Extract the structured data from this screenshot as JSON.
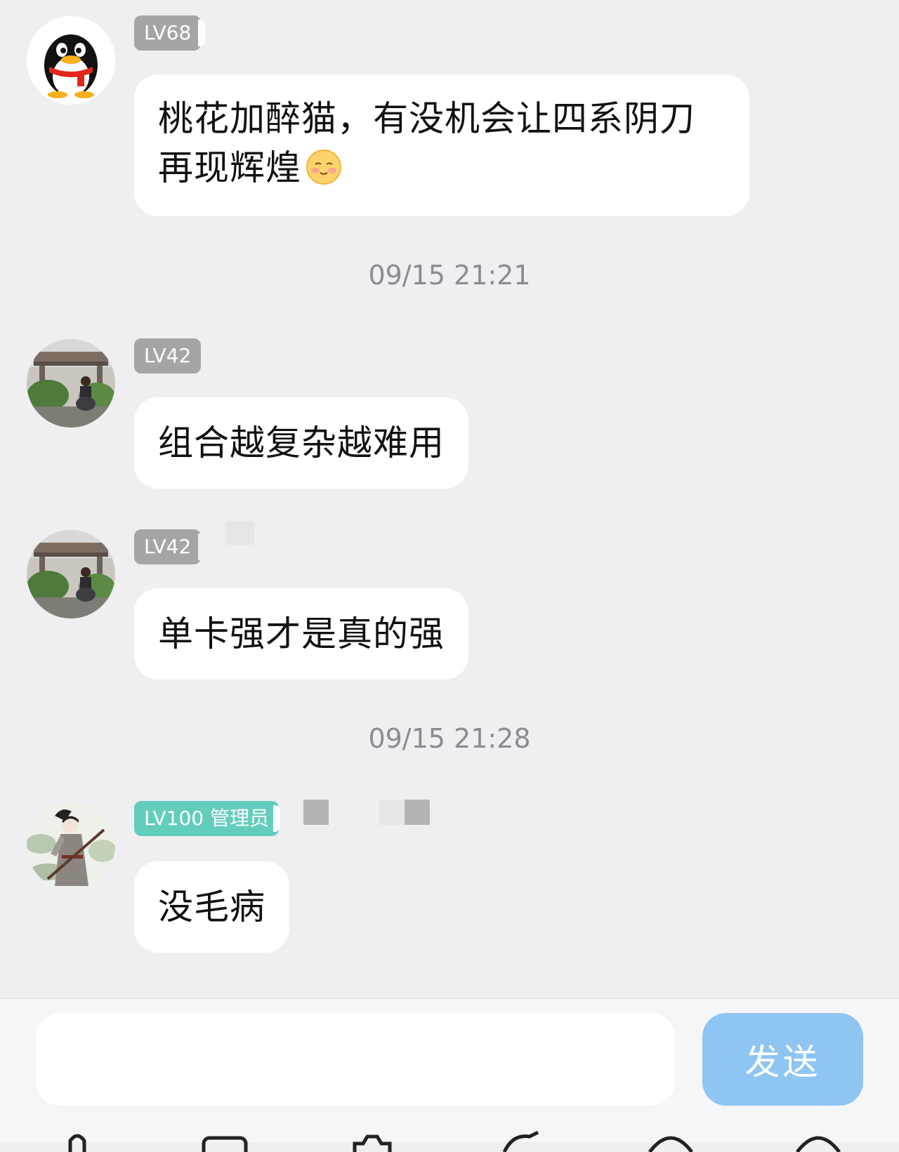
{
  "messages": [
    {
      "avatar": "qq-penguin-avatar",
      "level": "LV68",
      "text_line1": "桃花加醉猫，有没机会让四系阴刀",
      "text_line2": "再现辉煌",
      "emoji": "blush-smile-emoji"
    },
    {
      "avatar": "photo-gate-avatar",
      "level": "LV42",
      "text": "组合越复杂越难用"
    },
    {
      "avatar": "photo-gate-avatar",
      "level": "LV42",
      "text": "单卡强才是真的强"
    },
    {
      "avatar": "ink-painting-swordsman-avatar",
      "level": "LV100 管理员",
      "text": "没毛病"
    }
  ],
  "timestamps": [
    "09/15 21:21",
    "09/15 21:28"
  ],
  "composer": {
    "input_value": "",
    "send_label": "发送"
  },
  "colors": {
    "background": "#efeff1",
    "bubble": "#ffffff",
    "level_badge": "#a5a5a8",
    "admin_badge": "#63cdbc",
    "send_button": "#8ec5f2",
    "timestamp": "#8b8b90"
  }
}
